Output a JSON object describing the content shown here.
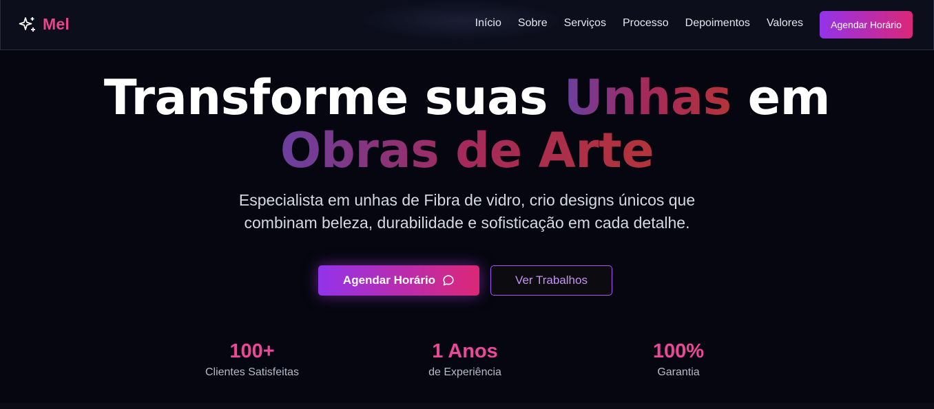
{
  "header": {
    "logo_icon": "sparkles-icon",
    "brand": "Mel",
    "nav": [
      "Início",
      "Sobre",
      "Serviços",
      "Processo",
      "Depoimentos",
      "Valores"
    ],
    "cta_label": "Agendar Horário"
  },
  "hero": {
    "title_part1": "Transforme suas ",
    "title_highlight1": "Unhas",
    "title_part2": " em",
    "title_highlight2": "Obras de Arte",
    "subtitle_line1": "Especialista em unhas de Fibra de vidro, crio designs únicos que",
    "subtitle_line2": "combinam beleza, durabilidade e sofisticação em cada detalhe.",
    "primary_button": "Agendar Horário",
    "primary_button_icon": "chat-bubble-icon",
    "secondary_button": "Ver Trabalhos"
  },
  "stats": [
    {
      "value": "100+",
      "label": "Clientes Satisfeitas"
    },
    {
      "value": "1 Anos",
      "label": "de Experiência"
    },
    {
      "value": "100%",
      "label": "Garantia"
    }
  ],
  "colors": {
    "background": "#05060f",
    "header_bg": "#0c0e1c",
    "accent_pink": "#ec4899",
    "accent_purple": "#9333ea",
    "gradient_end": "#db2777"
  }
}
